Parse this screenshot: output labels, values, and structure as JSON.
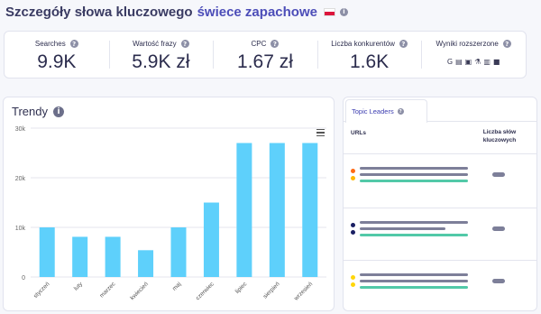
{
  "header": {
    "title": "Szczegóły słowa kluczowego",
    "keyword": "świece zapachowe",
    "flag_icon": "poland-flag-icon",
    "info_icon": "info-icon"
  },
  "stats": [
    {
      "label": "Searches",
      "value": "9.9K"
    },
    {
      "label": "Wartość frazy",
      "value": "5.9K zł"
    },
    {
      "label": "CPC",
      "value": "1.67 zł"
    },
    {
      "label": "Liczba konkurentów",
      "value": "1.6K"
    },
    {
      "label": "Wyniki rozszerzone",
      "icons": [
        "G",
        "▤",
        "▣",
        "⚗",
        "▥",
        "■"
      ]
    }
  ],
  "trendy": {
    "title": "Trendy",
    "menu_icon": "hamburger-menu-icon"
  },
  "chart_data": {
    "type": "bar",
    "categories": [
      "styczeń",
      "luty",
      "marzec",
      "kwiecień",
      "maj",
      "czerwiec",
      "lipiec",
      "sierpień",
      "wrzesień"
    ],
    "values": [
      10000,
      8100,
      8100,
      5400,
      10000,
      15000,
      27000,
      27000,
      27000
    ],
    "ylim": [
      0,
      30000
    ],
    "yticks": [
      "0",
      "10k",
      "20k",
      "30k"
    ],
    "grid": true,
    "bar_color": "#5ed0fb"
  },
  "topic": {
    "tab_label": "Topic Leaders",
    "col_urls": "URLs",
    "col_count": "Liczba słów kluczowych",
    "rows": [
      {
        "dots": [
          "#ff6a14",
          "#ffb703"
        ]
      },
      {
        "dots": [
          "#1a1f63",
          "#1a1f63"
        ]
      },
      {
        "dots": [
          "#ffd60a",
          "#ffd60a"
        ]
      }
    ]
  },
  "colors": {
    "accent": "#4c4db8",
    "bar": "#5ed0fb",
    "placeholder_gray": "#7d7f99",
    "placeholder_green": "#52c9a8"
  }
}
